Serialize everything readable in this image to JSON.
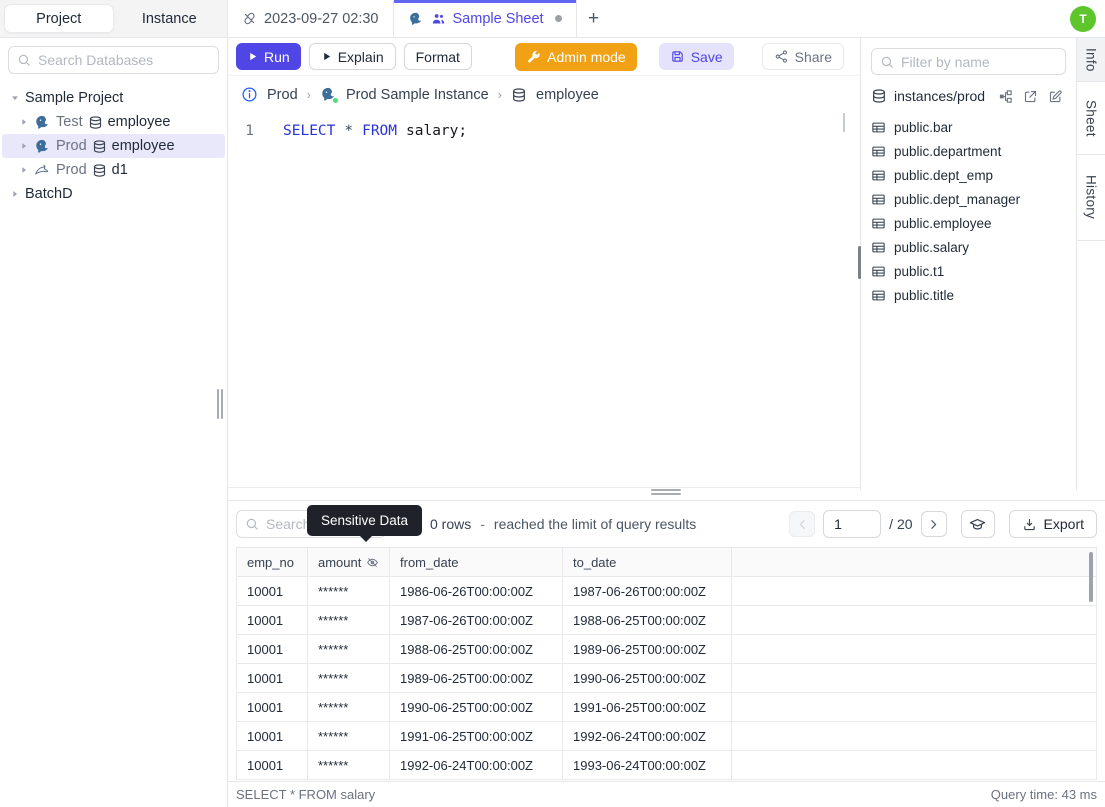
{
  "window": {
    "avatar_initial": "T"
  },
  "sidebar": {
    "tabs": {
      "project": "Project",
      "instance": "Instance"
    },
    "search_placeholder": "Search Databases",
    "tree": [
      {
        "label": "Sample Project"
      },
      {
        "env": "Test",
        "database": "employee",
        "engine": "postgres"
      },
      {
        "env": "Prod",
        "database": "employee",
        "engine": "postgres"
      },
      {
        "env": "Prod",
        "database": "d1",
        "engine": "mysql"
      },
      {
        "label": "BatchD"
      }
    ]
  },
  "tabbar": {
    "history_tab": "2023-09-27 02:30",
    "sheet_tab": "Sample Sheet",
    "new_tab": "+"
  },
  "toolbar": {
    "run": "Run",
    "explain": "Explain",
    "format": "Format",
    "admin_mode": "Admin mode",
    "save": "Save",
    "share": "Share"
  },
  "breadcrumb": {
    "environment": "Prod",
    "instance": "Prod Sample Instance",
    "database": "employee",
    "separator": "›"
  },
  "editor": {
    "line_number": "1",
    "tokens": {
      "kw_select": "SELECT",
      "star": "*",
      "kw_from": "FROM",
      "rest": "salary;"
    }
  },
  "schema_panel": {
    "filter_placeholder": "Filter by name",
    "connection": "instances/prod",
    "tables": [
      "public.bar",
      "public.department",
      "public.dept_emp",
      "public.dept_manager",
      "public.employee",
      "public.salary",
      "public.t1",
      "public.title"
    ]
  },
  "right_rail": {
    "tabs": [
      "Info",
      "Sheet",
      "History"
    ]
  },
  "results": {
    "search_placeholder": "Search",
    "tooltip": "Sensitive Data",
    "row_count": "0 rows",
    "dash": "-",
    "limit_message": "reached the limit of query results",
    "page_value": "1",
    "page_total": "/ 20",
    "export_label": "Export",
    "columns": [
      "emp_no",
      "amount",
      "from_date",
      "to_date"
    ],
    "rows": [
      [
        "10001",
        "******",
        "1986-06-26T00:00:00Z",
        "1987-06-26T00:00:00Z"
      ],
      [
        "10001",
        "******",
        "1987-06-26T00:00:00Z",
        "1988-06-25T00:00:00Z"
      ],
      [
        "10001",
        "******",
        "1988-06-25T00:00:00Z",
        "1989-06-25T00:00:00Z"
      ],
      [
        "10001",
        "******",
        "1989-06-25T00:00:00Z",
        "1990-06-25T00:00:00Z"
      ],
      [
        "10001",
        "******",
        "1990-06-25T00:00:00Z",
        "1991-06-25T00:00:00Z"
      ],
      [
        "10001",
        "******",
        "1991-06-25T00:00:00Z",
        "1992-06-24T00:00:00Z"
      ],
      [
        "10001",
        "******",
        "1992-06-24T00:00:00Z",
        "1993-06-24T00:00:00Z"
      ]
    ],
    "status_sql": "SELECT * FROM salary",
    "query_time": "Query time: 43 ms"
  },
  "colors": {
    "accent_indigo": "#4F46E5",
    "tab_indicator": "#6366F1",
    "admin_orange": "#F0A114",
    "save_button_bg": "#E5E2FB",
    "selected_tree_row": "#E9E8FB",
    "avatar_green": "#5EC52D",
    "online_dot_green": "#4ADE80",
    "tooltip_bg": "#1F2329",
    "sql_keyword_blue": "#2A33D8",
    "info_icon_blue": "#2563EB"
  }
}
